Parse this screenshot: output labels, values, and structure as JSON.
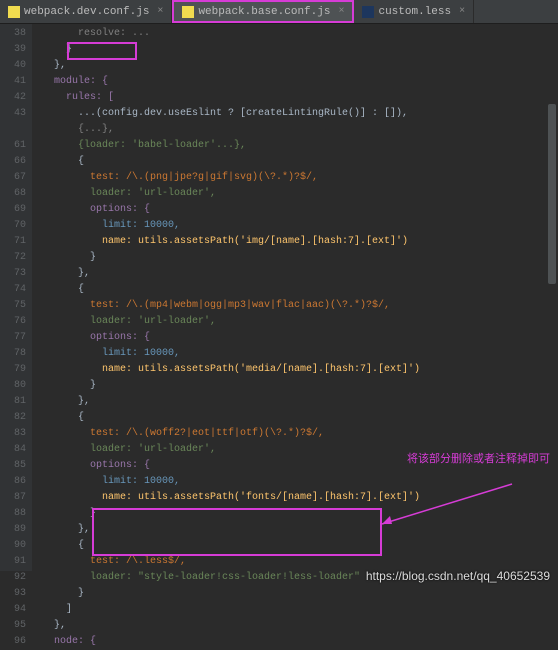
{
  "tabs": [
    {
      "name": "webpack.dev.conf.js"
    },
    {
      "name": "webpack.base.conf.js"
    },
    {
      "name": "custom.less"
    }
  ],
  "gutter": [
    "38",
    "39",
    "40",
    "41",
    "42",
    "43",
    "",
    "61",
    "66",
    "67",
    "68",
    "69",
    "70",
    "71",
    "72",
    "73",
    "74",
    "75",
    "76",
    "77",
    "78",
    "79",
    "80",
    "81",
    "82",
    "83",
    "84",
    "85",
    "86",
    "87",
    "88",
    "89",
    "90",
    "91",
    "92",
    "93",
    "94",
    "95",
    "96"
  ],
  "code": {
    "l0": "      resolve: ...",
    "l1": "    }",
    "l2": "  },",
    "l3": "  module: {",
    "l4": "    rules: [",
    "l5": "      ...(config.dev.useEslint ? [createLintingRule()] : []),",
    "l6": "      {...},",
    "l7": "      {loader: 'babel-loader'...},",
    "l8": "      {",
    "l9": "        test: /\\.(png|jpe?g|gif|svg)(\\?.*)?$/,",
    "l10": "        loader: 'url-loader',",
    "l11": "        options: {",
    "l12": "          limit: 10000,",
    "l13": "          name: utils.assetsPath('img/[name].[hash:7].[ext]')",
    "l14": "        }",
    "l15": "      },",
    "l16": "      {",
    "l17": "        test: /\\.(mp4|webm|ogg|mp3|wav|flac|aac)(\\?.*)?$/,",
    "l18": "        loader: 'url-loader',",
    "l19": "        options: {",
    "l20": "          limit: 10000,",
    "l21": "          name: utils.assetsPath('media/[name].[hash:7].[ext]')",
    "l22": "        }",
    "l23": "      },",
    "l24": "      {",
    "l25": "        test: /\\.(woff2?|eot|ttf|otf)(\\?.*)?$/,",
    "l26": "        loader: 'url-loader',",
    "l27": "        options: {",
    "l28": "          limit: 10000,",
    "l29": "          name: utils.assetsPath('fonts/[name].[hash:7].[ext]')",
    "l30": "        }",
    "l31": "      },",
    "l32": "      {",
    "l33": "        test: /\\.less$/,",
    "l34": "        loader: \"style-loader!css-loader!less-loader\"",
    "l35": "      }",
    "l36": "    ]",
    "l37": "  },",
    "l38": "  node: {"
  },
  "annotation": "将该部分删除或者注释掉即可",
  "watermark": "https://blog.csdn.net/qq_40652539"
}
